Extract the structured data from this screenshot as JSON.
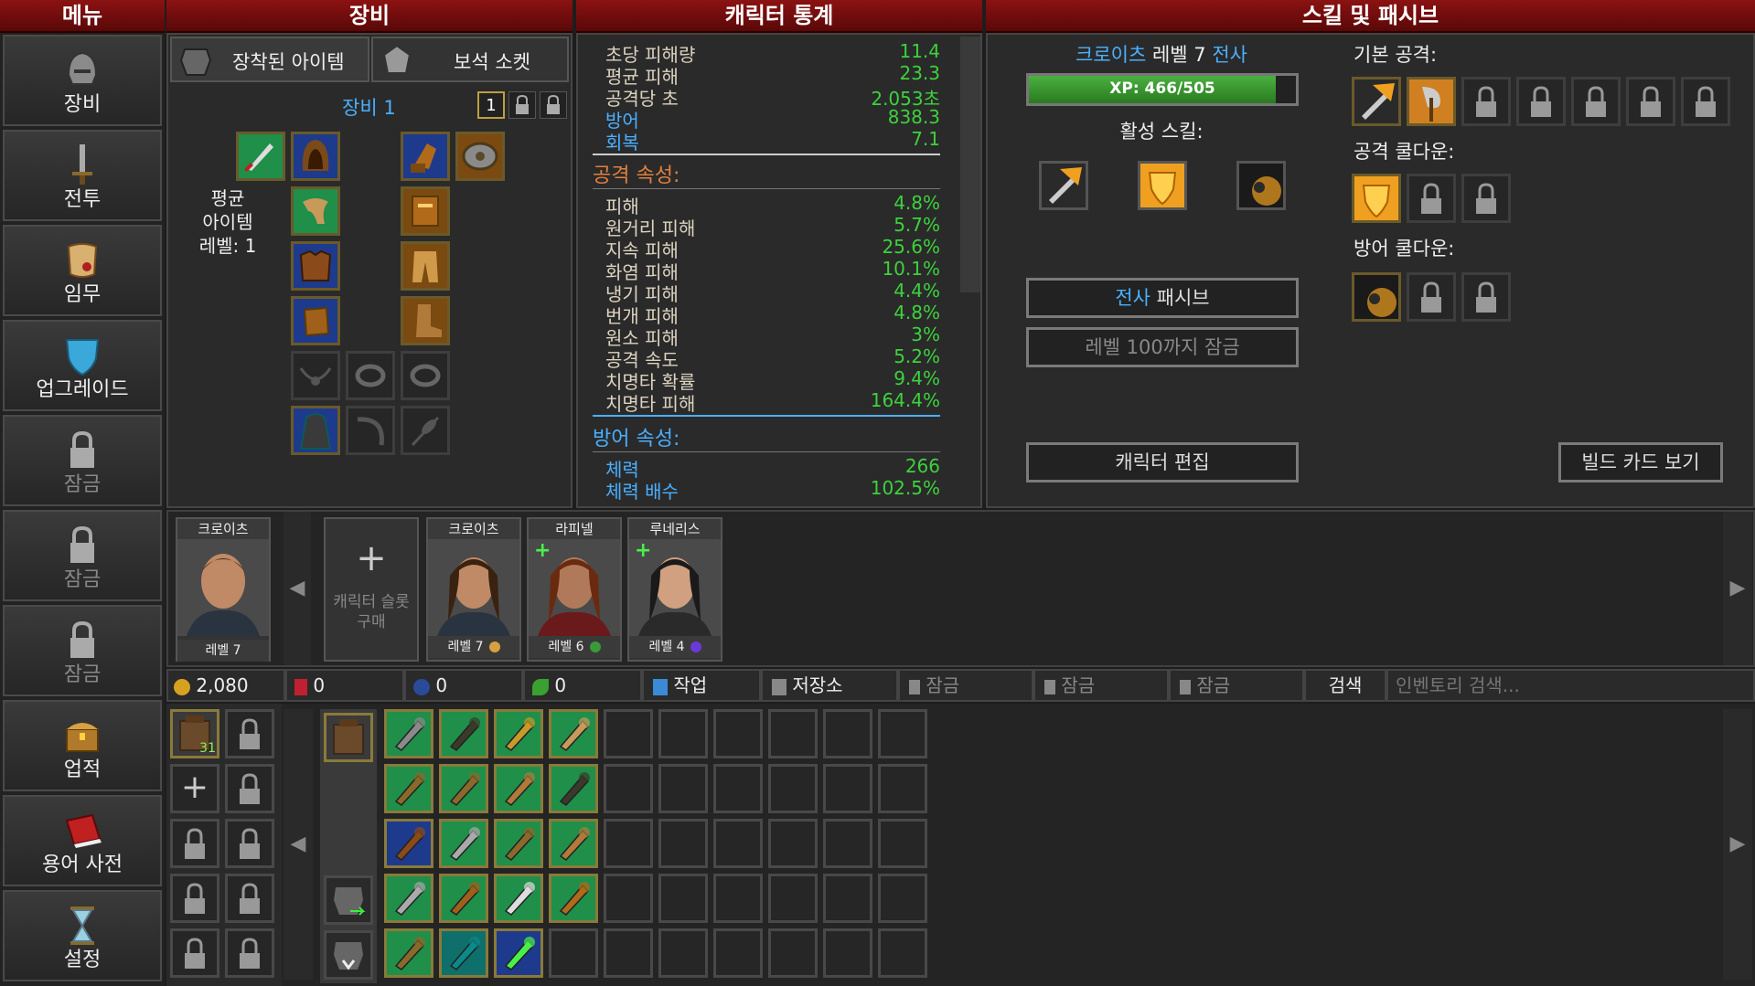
{
  "headers": {
    "menu": "메뉴",
    "equipment": "장비",
    "stats": "캐릭터 통계",
    "skills": "스킬 및 패시브"
  },
  "nav": [
    {
      "label": "장비",
      "icon": "helmet-icon",
      "locked": false
    },
    {
      "label": "전투",
      "icon": "sword-icon",
      "locked": false
    },
    {
      "label": "임무",
      "icon": "scroll-icon",
      "locked": false
    },
    {
      "label": "업그레이드",
      "icon": "shield-icon",
      "locked": false
    },
    {
      "label": "잠금",
      "icon": "lock-icon",
      "locked": true
    },
    {
      "label": "잠금",
      "icon": "lock-icon",
      "locked": true
    },
    {
      "label": "잠금",
      "icon": "lock-icon",
      "locked": true
    },
    {
      "label": "업적",
      "icon": "chest-icon",
      "locked": false
    },
    {
      "label": "용어 사전",
      "icon": "book-icon",
      "locked": false
    },
    {
      "label": "설정",
      "icon": "hourglass-icon",
      "locked": false
    }
  ],
  "equip": {
    "tab_equipped": "장착된 아이템",
    "tab_socket": "보석 소켓",
    "set_title": "장비 1",
    "set_num": "1",
    "avg_label": "평균",
    "avg_label2": "아이템",
    "avg_level": "레벨: 1"
  },
  "stats": {
    "basic": [
      {
        "k": "초당 피해량",
        "v": "11.4",
        "kc": "#dcd3c0"
      },
      {
        "k": "평균 피해",
        "v": "23.3",
        "kc": "#dcd3c0"
      },
      {
        "k": "공격당 초",
        "v": "2.053초",
        "kc": "#dcd3c0"
      },
      {
        "k": "방어",
        "v": "838.3",
        "kc": "#4ab0ff"
      },
      {
        "k": "회복",
        "v": "7.1",
        "kc": "#4ab0ff"
      }
    ],
    "attack_title": "공격 속성:",
    "attack": [
      {
        "k": "피해",
        "v": "4.8%"
      },
      {
        "k": "원거리 피해",
        "v": "5.7%"
      },
      {
        "k": "지속 피해",
        "v": "25.6%"
      },
      {
        "k": "화염 피해",
        "v": "10.1%"
      },
      {
        "k": "냉기 피해",
        "v": "4.4%"
      },
      {
        "k": "번개 피해",
        "v": "4.8%"
      },
      {
        "k": "원소 피해",
        "v": "3%"
      },
      {
        "k": "공격 속도",
        "v": "5.2%"
      },
      {
        "k": "치명타 확률",
        "v": "9.4%"
      },
      {
        "k": "치명타 피해",
        "v": "164.4%"
      }
    ],
    "defense_title": "방어 속성:",
    "defense": [
      {
        "k": "체력",
        "v": "266"
      },
      {
        "k": "체력 배수",
        "v": "102.5%"
      }
    ]
  },
  "skills": {
    "char_name": "크로이츠",
    "char_level": "레벨 7",
    "char_class": "전사",
    "xp": "XP: 466/505",
    "xp_fraction": 0.923,
    "active_label": "활성 스킬:",
    "basic_label": "기본 공격:",
    "atk_cd_label": "공격 쿨다운:",
    "def_cd_label": "방어 쿨다운:",
    "passive_class": "전사",
    "passive_word": "패시브",
    "locked_btn": "레벨 100까지 잠금",
    "edit_btn": "캐릭터 편집",
    "build_btn": "빌드 카드 보기"
  },
  "roster": {
    "active": {
      "name": "크로이츠",
      "level": "레벨 7"
    },
    "buy_slot": "캐릭터 슬롯 구매",
    "members": [
      {
        "name": "크로이츠",
        "level": "레벨 7",
        "plus": false
      },
      {
        "name": "라피넬",
        "level": "레벨 6",
        "plus": true
      },
      {
        "name": "루네리스",
        "level": "레벨 4",
        "plus": true
      }
    ]
  },
  "resources": {
    "gold": "2,080",
    "res2": "0",
    "res3": "0",
    "res4": "0"
  },
  "tabs": {
    "craft": "작업",
    "storage": "저장소",
    "lock1": "잠금",
    "lock2": "잠금",
    "lock3": "잠금",
    "search": "검색",
    "search_placeholder": "인벤토리 검색..."
  },
  "inventory": {
    "bag_count": "31"
  }
}
